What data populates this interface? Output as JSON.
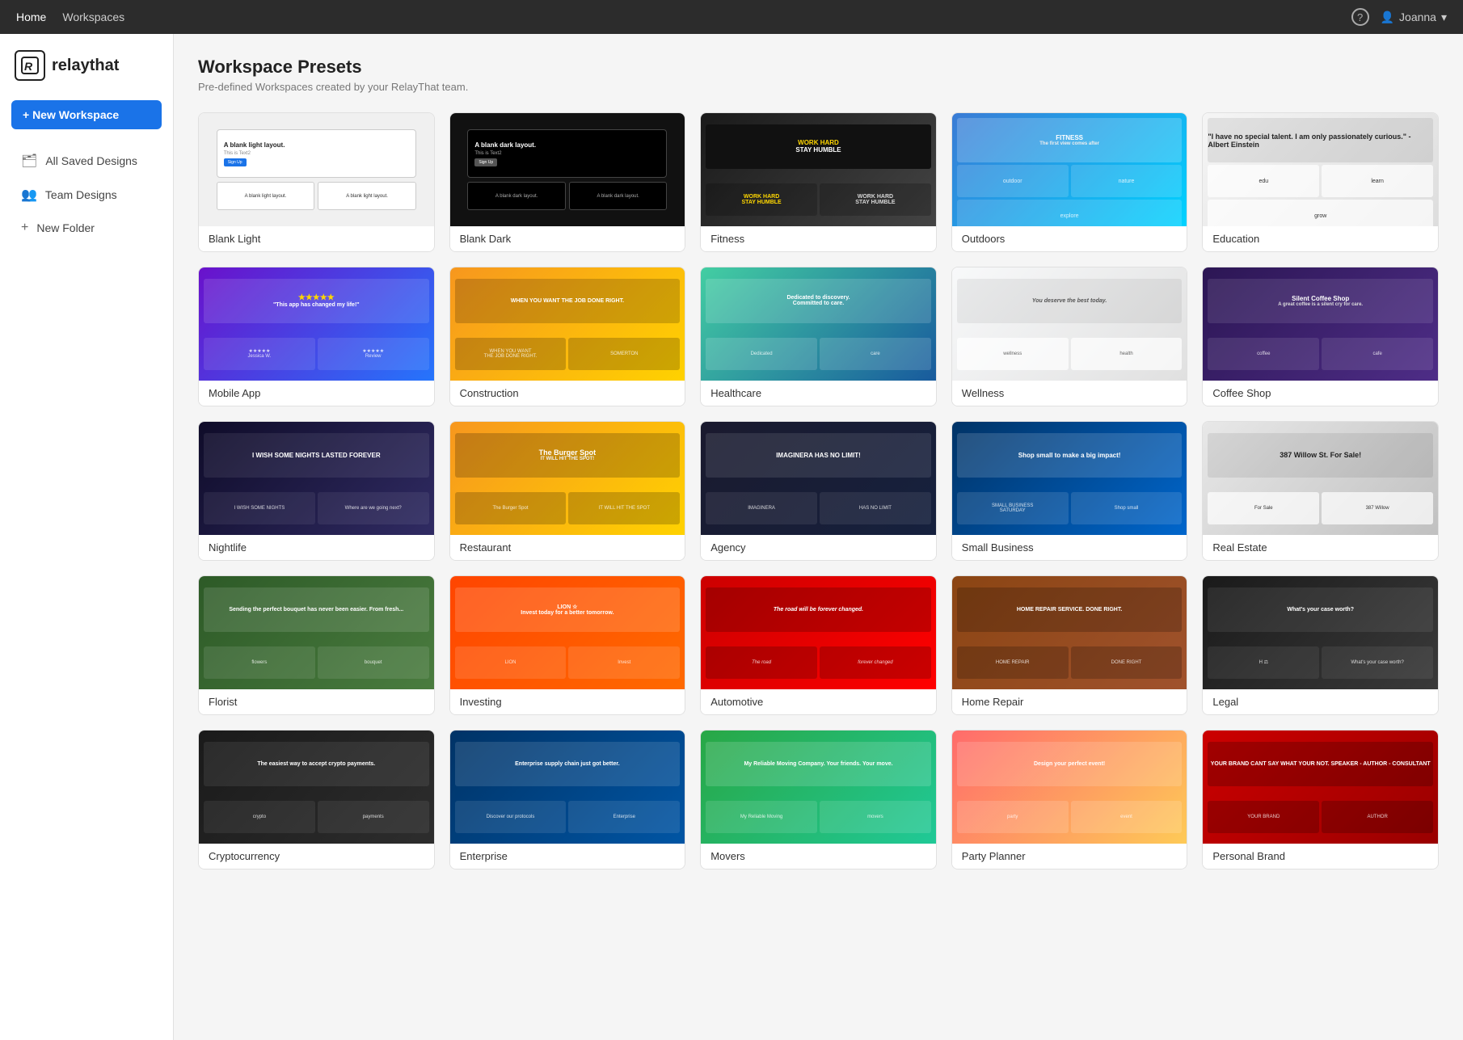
{
  "topnav": {
    "links": [
      {
        "label": "Home",
        "active": true
      },
      {
        "label": "Workspaces",
        "active": false
      }
    ],
    "help_title": "Help",
    "user": {
      "name": "Joanna",
      "icon": "▾"
    }
  },
  "sidebar": {
    "logo": {
      "icon": "R",
      "text_regular": "relay",
      "text_bold": "that"
    },
    "new_workspace_btn": "+ New Workspace",
    "items": [
      {
        "label": "All Saved Designs",
        "icon": "🗂",
        "active": false
      },
      {
        "label": "Team Designs",
        "icon": "👥",
        "active": false
      },
      {
        "label": "New Folder",
        "icon": "+",
        "active": false
      }
    ]
  },
  "main": {
    "title": "Workspace Presets",
    "subtitle": "Pre-defined Workspaces created by your RelayThat team.",
    "presets": [
      {
        "id": "blank-light",
        "label": "Blank Light",
        "thumb_type": "blank-light"
      },
      {
        "id": "blank-dark",
        "label": "Blank Dark",
        "thumb_type": "blank-dark"
      },
      {
        "id": "fitness",
        "label": "Fitness",
        "thumb_type": "fitness"
      },
      {
        "id": "outdoors",
        "label": "Outdoors",
        "thumb_type": "outdoors"
      },
      {
        "id": "education",
        "label": "Education",
        "thumb_type": "education"
      },
      {
        "id": "mobile-app",
        "label": "Mobile App",
        "thumb_type": "mobileapp"
      },
      {
        "id": "construction",
        "label": "Construction",
        "thumb_type": "construction"
      },
      {
        "id": "healthcare",
        "label": "Healthcare",
        "thumb_type": "healthcare"
      },
      {
        "id": "wellness",
        "label": "Wellness",
        "thumb_type": "wellness"
      },
      {
        "id": "coffee-shop",
        "label": "Coffee Shop",
        "thumb_type": "coffeeshop"
      },
      {
        "id": "nightlife",
        "label": "Nightlife",
        "thumb_type": "nightlife"
      },
      {
        "id": "restaurant",
        "label": "Restaurant",
        "thumb_type": "restaurant"
      },
      {
        "id": "agency",
        "label": "Agency",
        "thumb_type": "agency"
      },
      {
        "id": "small-business",
        "label": "Small Business",
        "thumb_type": "smallbiz"
      },
      {
        "id": "real-estate",
        "label": "Real Estate",
        "thumb_type": "realestate"
      },
      {
        "id": "florist",
        "label": "Florist",
        "thumb_type": "florist"
      },
      {
        "id": "investing",
        "label": "Investing",
        "thumb_type": "investing"
      },
      {
        "id": "automotive",
        "label": "Automotive",
        "thumb_type": "automotive"
      },
      {
        "id": "home-repair",
        "label": "Home Repair",
        "thumb_type": "homerepair"
      },
      {
        "id": "legal",
        "label": "Legal",
        "thumb_type": "legal"
      },
      {
        "id": "cryptocurrency",
        "label": "Cryptocurrency",
        "thumb_type": "crypto"
      },
      {
        "id": "enterprise",
        "label": "Enterprise",
        "thumb_type": "enterprise"
      },
      {
        "id": "movers",
        "label": "Movers",
        "thumb_type": "movers"
      },
      {
        "id": "party-planner",
        "label": "Party Planner",
        "thumb_type": "partyplanner"
      },
      {
        "id": "personal-brand",
        "label": "Personal Brand",
        "thumb_type": "personal"
      }
    ]
  }
}
